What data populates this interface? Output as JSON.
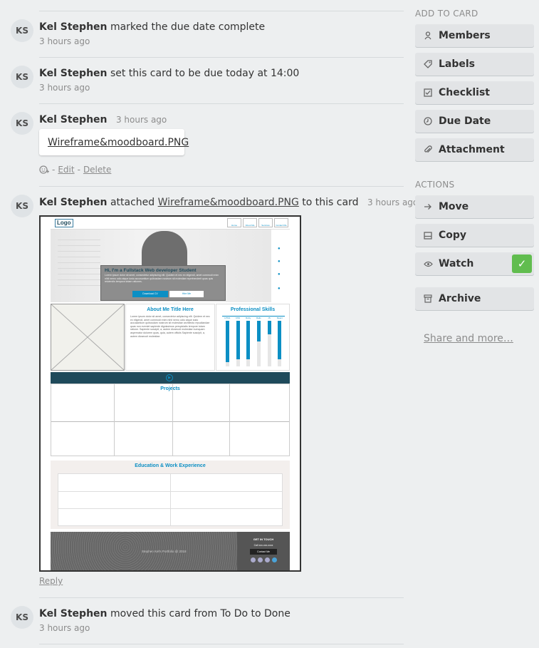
{
  "activity": [
    {
      "initials": "KS",
      "author": "Kel Stephen",
      "text": "marked the due date complete",
      "time": "3 hours ago"
    },
    {
      "initials": "KS",
      "author": "Kel Stephen",
      "text": "set this card to be due today at 14:00",
      "time": "3 hours ago"
    },
    {
      "initials": "KS",
      "author": "Kel Stephen",
      "time": "3 hours ago",
      "attachment": "Wireframe&moodboard.PNG",
      "actions": {
        "sep": "-",
        "edit": "Edit",
        "delete": "Delete"
      }
    },
    {
      "initials": "KS",
      "author": "Kel Stephen",
      "text_before": "attached",
      "link": "Wireframe&moodboard.PNG",
      "text_after": "to this card",
      "time": "3 hours ago",
      "reply": "Reply"
    },
    {
      "initials": "KS",
      "author": "Kel Stephen",
      "text": "moved this card from To Do to Done",
      "time": "3 hours ago"
    }
  ],
  "preview": {
    "logo": "Logo",
    "nav": [
      "Home",
      "About Me",
      "Services",
      "Contact Me"
    ],
    "hero_title": "Hi, I'm a Fullstack Web developer Student",
    "hero_text": "Lorem ipsum dolor sit amet, consectetur adipiscing elit. Quidem et nec ex eligendi, amet commodi enim nihil nemo odio atque iusto accusantium quibusdam nostrum sit molestiae reprehenderit quas quis reiciendis tempora totam rationes.",
    "hero_btn1": "Download CV",
    "hero_btn2": "Hire Me",
    "about_title": "About Me Title Here",
    "about_p": "Lorem ipsum dolor sit amet, consectetur adipiscing elit. Quidem et nec ex eligendi, amet commodi enim nihil nemo odio atque iusto accusantium quibusdam nostrum sit molestiae architecto repudiandae quas non eveniet sapiente dignissimos perspiciatis tempore totam ratione. Sapiente suscipit, a, autem dicsecuti molestiae numquam aspernatur dolorem quas, quia, autem officiis Sapiente suscipit, a, autem dicsecuti molestiae.",
    "skills_title": "Professional Skills",
    "skills": [
      {
        "name": "HTML",
        "level": 0.9
      },
      {
        "name": "CSS",
        "level": 0.85
      },
      {
        "name": "Ruby",
        "level": 0.85
      },
      {
        "name": "Rails",
        "level": 0.45
      },
      {
        "name": "JS",
        "level": 0.3
      },
      {
        "name": "React",
        "level": 0.85
      }
    ],
    "projects_title": "Projects",
    "edu_title": "Education & Work Experience",
    "footer_copy": "Stephen Kel's Portfolio @ 2018",
    "footer_get": "GET IN TOUCH",
    "footer_call": "Call xxx-xxx-xxxx",
    "footer_btn": "Contact Me"
  },
  "sidebar": {
    "add_heading": "ADD TO CARD",
    "add": [
      {
        "label": "Members",
        "icon": "person-icon"
      },
      {
        "label": "Labels",
        "icon": "tag-icon"
      },
      {
        "label": "Checklist",
        "icon": "checklist-icon"
      },
      {
        "label": "Due Date",
        "icon": "clock-icon"
      },
      {
        "label": "Attachment",
        "icon": "paperclip-icon"
      }
    ],
    "actions_heading": "ACTIONS",
    "actions": [
      {
        "label": "Move",
        "icon": "arrow-right-icon"
      },
      {
        "label": "Copy",
        "icon": "copy-icon"
      },
      {
        "label": "Watch",
        "icon": "eye-icon",
        "checked": true
      },
      {
        "label": "Archive",
        "icon": "archive-icon"
      }
    ],
    "share": "Share and more…"
  },
  "colors": {
    "accent": "#0c8fc4",
    "watch_check": "#61bd4f",
    "preview_bar": "#1f4a5b"
  }
}
